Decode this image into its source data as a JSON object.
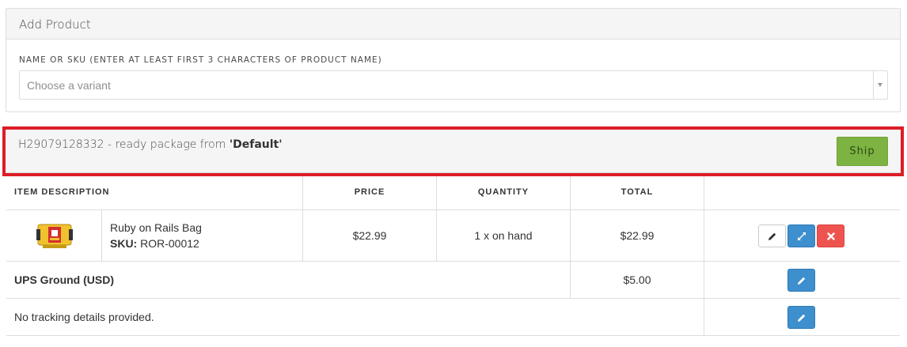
{
  "add_product": {
    "title": "Add Product",
    "field_label": "NAME OR SKU (ENTER AT LEAST FIRST 3 CHARACTERS OF PRODUCT NAME)",
    "select_placeholder": "Choose a variant"
  },
  "shipment": {
    "title_prefix": "H29079128332 - ready package from ",
    "title_bold": "'Default'",
    "ship_button": "Ship"
  },
  "table": {
    "headers": {
      "item_description": "ITEM DESCRIPTION",
      "price": "PRICE",
      "quantity": "QUANTITY",
      "total": "TOTAL"
    },
    "items": [
      {
        "name": "Ruby on Rails Bag",
        "sku_label": "SKU:",
        "sku": "ROR-00012",
        "price": "$22.99",
        "quantity": "1 x on hand",
        "total": "$22.99"
      }
    ],
    "shipping": {
      "method": "UPS Ground (USD)",
      "cost": "$5.00"
    },
    "tracking": {
      "text": "No tracking details provided."
    }
  },
  "icons": {
    "edit": "pencil-icon",
    "split": "expand-arrows-icon",
    "delete": "close-icon"
  },
  "colors": {
    "ship_button": "#7cb342",
    "highlight": "#dd1d26",
    "blue_button": "#3d8fce",
    "red_button": "#ef5350"
  }
}
